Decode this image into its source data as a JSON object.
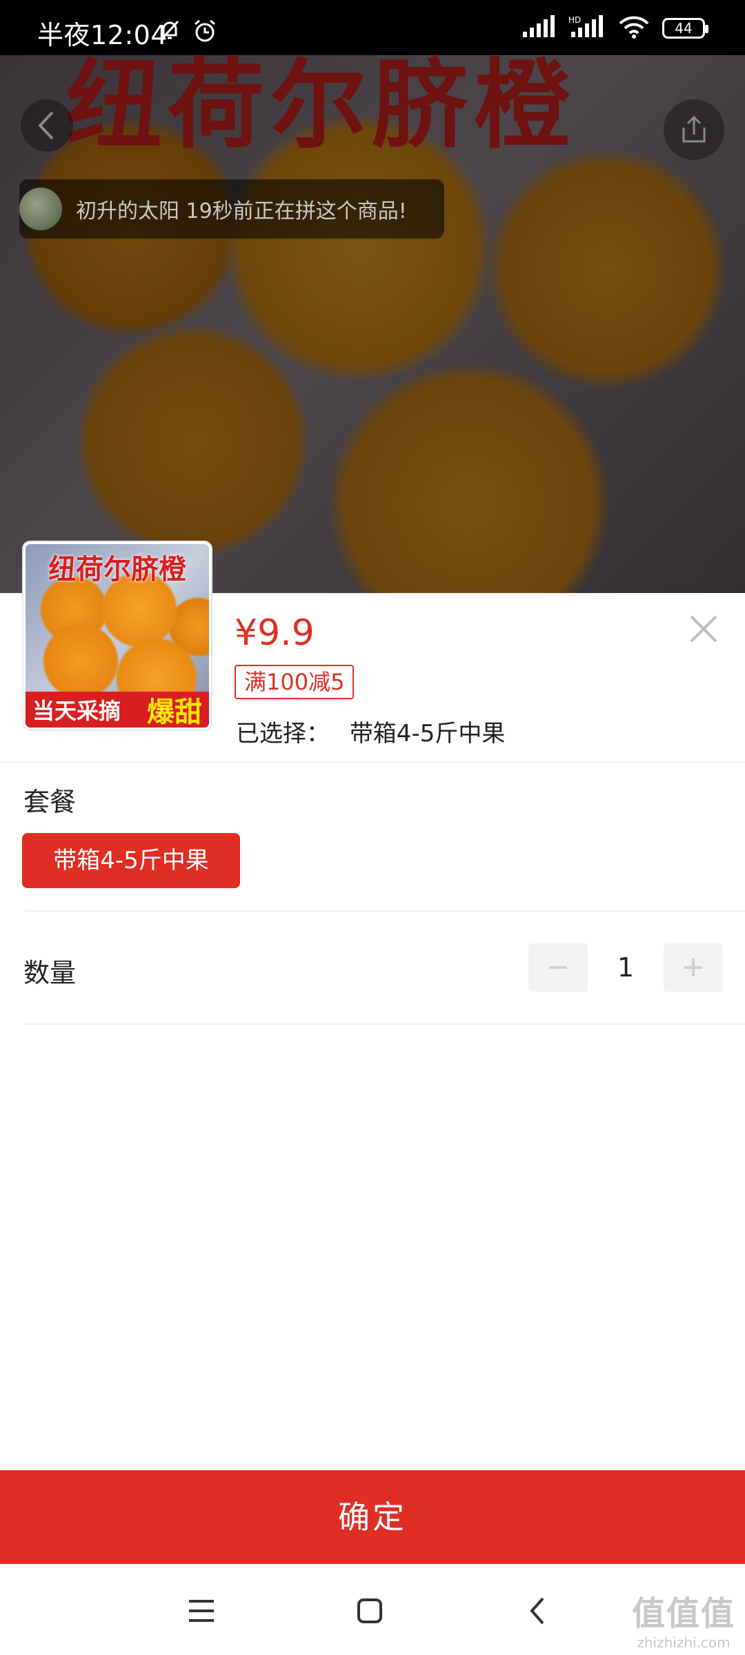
{
  "status_bar": {
    "time": "半夜12:04",
    "battery": "44",
    "icons": [
      "mute-bell-icon",
      "alarm-icon",
      "signal-icon",
      "hd-signal-icon",
      "wifi-icon",
      "battery-icon"
    ]
  },
  "hero": {
    "banner_text": "纽荷尔脐橙",
    "notice_text": "初升的太阳 19秒前正在拼这个商品!"
  },
  "product": {
    "thumb_title": "纽荷尔脐橙",
    "thumb_banner_left": "当天采摘",
    "thumb_banner_right": "爆甜",
    "price": "¥9.9",
    "promo": "满100减5",
    "selected_label": "已选择：",
    "selected_value": "带箱4-5斤中果"
  },
  "package": {
    "title": "套餐",
    "options": [
      "带箱4-5斤中果"
    ]
  },
  "quantity": {
    "title": "数量",
    "value": "1"
  },
  "confirm_label": "确定",
  "watermark": {
    "line1": "值值值",
    "line2": "zhizhizhi.com"
  },
  "colors": {
    "accent": "#e02e24",
    "status_bar": "#000000"
  }
}
